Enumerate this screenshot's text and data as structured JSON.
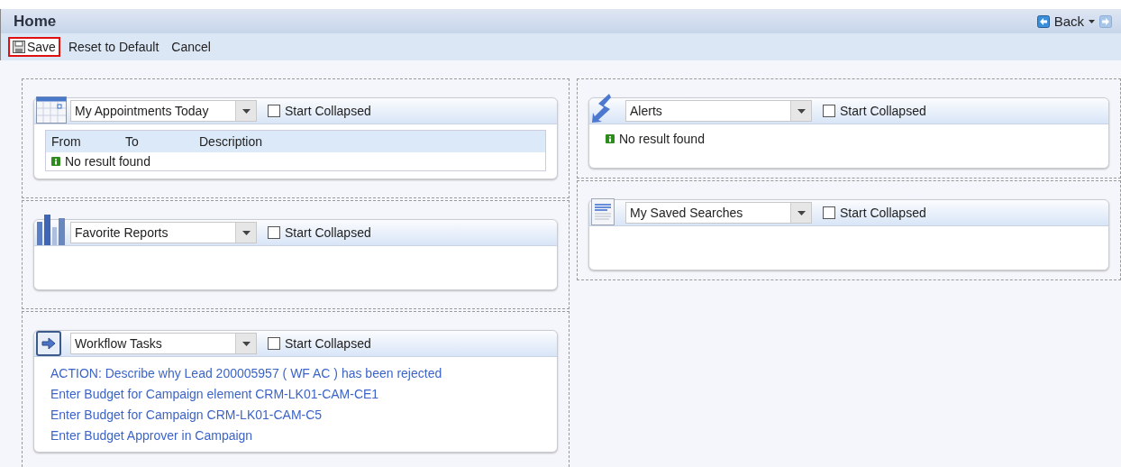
{
  "header": {
    "title": "Home",
    "back_label": "Back"
  },
  "toolbar": [
    {
      "label": "Save",
      "highlighted": true
    },
    {
      "label": "Reset to Default",
      "highlighted": false
    },
    {
      "label": "Cancel",
      "highlighted": false
    }
  ],
  "columns": [
    {
      "widgets": [
        {
          "kind": "table",
          "selection": "My Appointments Today",
          "start_collapsed": false,
          "checkbox_label": "Start Collapsed",
          "columns": [
            "From",
            "To",
            "Description"
          ],
          "message": "No result found"
        },
        {
          "kind": "empty",
          "selection": "Favorite Reports",
          "start_collapsed": false,
          "checkbox_label": "Start Collapsed"
        },
        {
          "kind": "links",
          "selection": "Workflow Tasks",
          "start_collapsed": false,
          "checkbox_label": "Start Collapsed",
          "links": [
            "ACTION: Describe why Lead 200005957 ( WF AC ) has been rejected",
            "Enter Budget for Campaign element CRM-LK01-CAM-CE1",
            "Enter Budget for Campaign CRM-LK01-CAM-C5",
            "Enter Budget Approver in Campaign"
          ]
        }
      ]
    },
    {
      "widgets": [
        {
          "kind": "message",
          "selection": "Alerts",
          "start_collapsed": false,
          "checkbox_label": "Start Collapsed",
          "message": "No result found"
        },
        {
          "kind": "empty",
          "selection": "My Saved Searches",
          "start_collapsed": false,
          "checkbox_label": "Start Collapsed"
        }
      ]
    }
  ]
}
